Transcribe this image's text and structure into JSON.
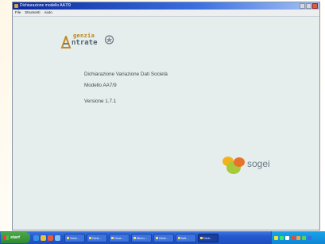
{
  "window": {
    "title": "Dichiarazione modello AA7/9",
    "menu": [
      "File",
      "Strumenti",
      "Aiuto"
    ]
  },
  "logo": {
    "line1": "genzia",
    "line2": "ntrate"
  },
  "info": {
    "title": "Dichiarazione Variazione Dati Società",
    "model": "Modello AA7/9",
    "version": "Versione 1.7.1"
  },
  "sogei": {
    "name": "sogei"
  },
  "taskbar": {
    "start_label": "start",
    "quicklaunch": [
      {
        "icon": "ie-icon",
        "color": "#3b8ee8"
      },
      {
        "icon": "outlook-icon",
        "color": "#e8c23b"
      },
      {
        "icon": "media-icon",
        "color": "#e85a3b"
      },
      {
        "icon": "desktop-icon",
        "color": "#7fc6f2"
      }
    ],
    "tasks": [
      "Gest...",
      "Gest...",
      "Gest...",
      "Micro...",
      "Gest...",
      "Istit...",
      "Dich..."
    ],
    "tray_icons": [
      {
        "icon": "tray-app-icon",
        "color": "#e8e23b"
      },
      {
        "icon": "tray-net-icon",
        "color": "#3be86a"
      },
      {
        "icon": "tray-volume-icon",
        "color": "#ffffff"
      },
      {
        "icon": "tray-security-icon",
        "color": "#e84a3b"
      },
      {
        "icon": "tray-update-icon",
        "color": "#f2a33b"
      },
      {
        "icon": "tray-msn-icon",
        "color": "#5ad15a"
      },
      {
        "icon": "tray-info-icon",
        "color": "#3b6ae8"
      }
    ]
  }
}
